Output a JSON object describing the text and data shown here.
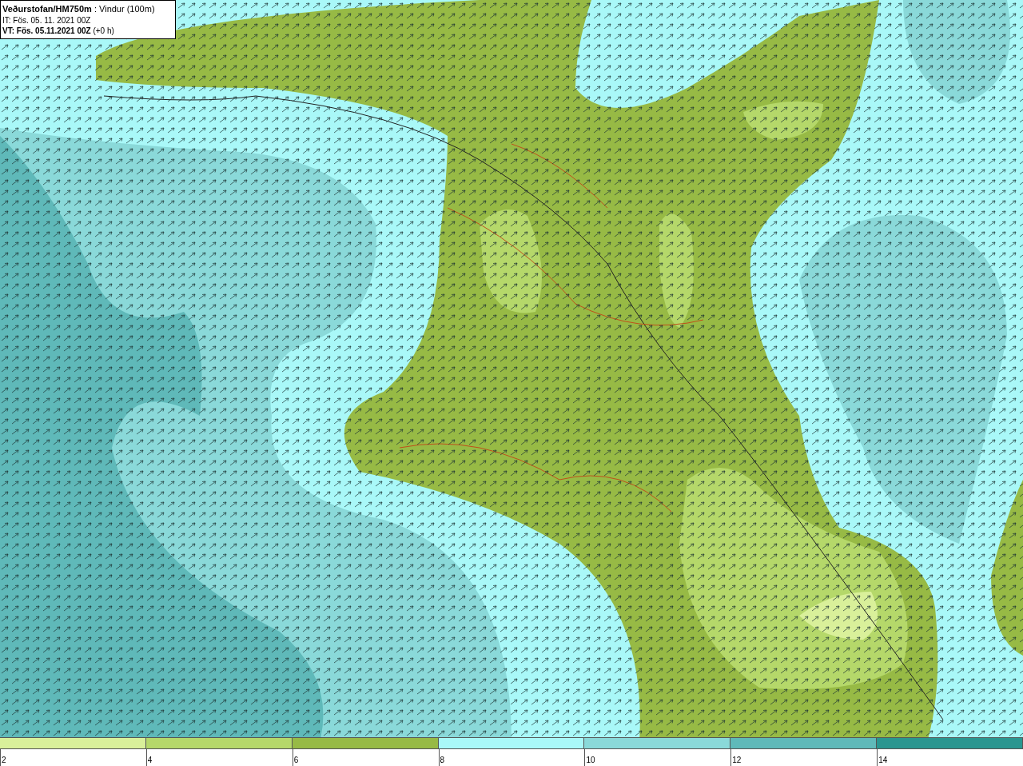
{
  "header": {
    "title": "**Veðurstofan/HM750m** : Vindur (100m)",
    "issue_time": "IT: Fös. 05. 11. 2021 00Z",
    "valid_time": "**VT: Fös. 05.11.2021 00Z** (+0 h)"
  },
  "legend": {
    "segments": [
      {
        "color": "#d9f09a"
      },
      {
        "color": "#b5d86a"
      },
      {
        "color": "#97ba45"
      },
      {
        "color": "#a9f8f8"
      },
      {
        "color": "#8ad9d9"
      },
      {
        "color": "#5fb9b9"
      },
      {
        "color": "#2a9690"
      }
    ],
    "ticks": [
      "2",
      "4",
      "6",
      "8",
      "10",
      "12",
      "14"
    ]
  }
}
